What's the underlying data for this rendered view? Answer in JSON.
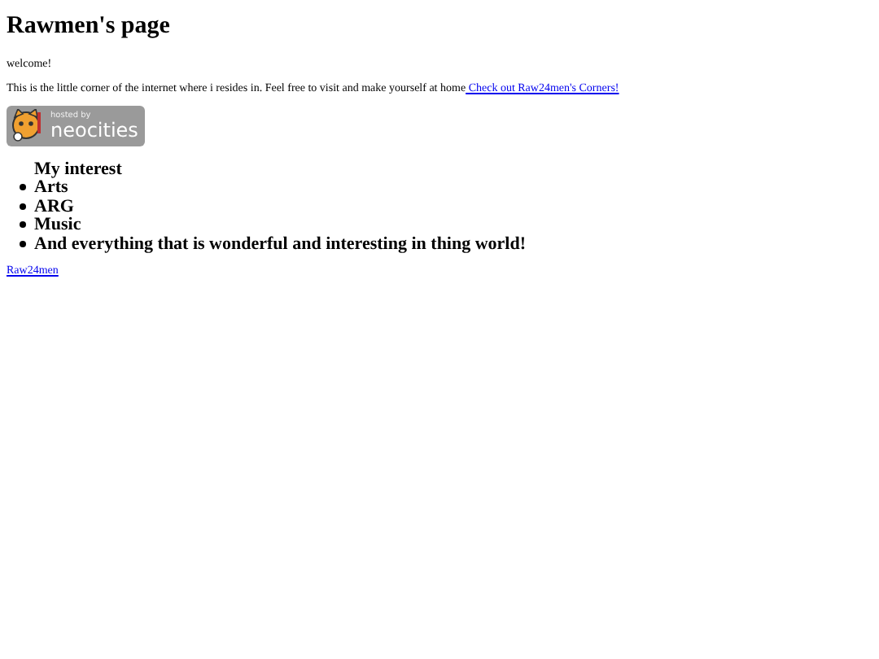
{
  "title": "Rawmen's page",
  "welcome": "welcome!",
  "intro": {
    "text": "This is the little corner of the internet where i resides in. Feel free to visit and make yourself at home",
    "link": " Check out Raw24men's Corners!"
  },
  "badge": {
    "small": "hosted by",
    "large": "neocities"
  },
  "interests": [
    {
      "kind": "label",
      "text": "My interest"
    },
    {
      "kind": "bullet",
      "text": "Arts"
    },
    {
      "kind": "bullet",
      "text": "ARG"
    },
    {
      "kind": "bullet",
      "text": "Music"
    },
    {
      "kind": "bullet",
      "text": "And everything that is wonderful and interesting in thing world!"
    }
  ],
  "footer_link": "Raw24men"
}
